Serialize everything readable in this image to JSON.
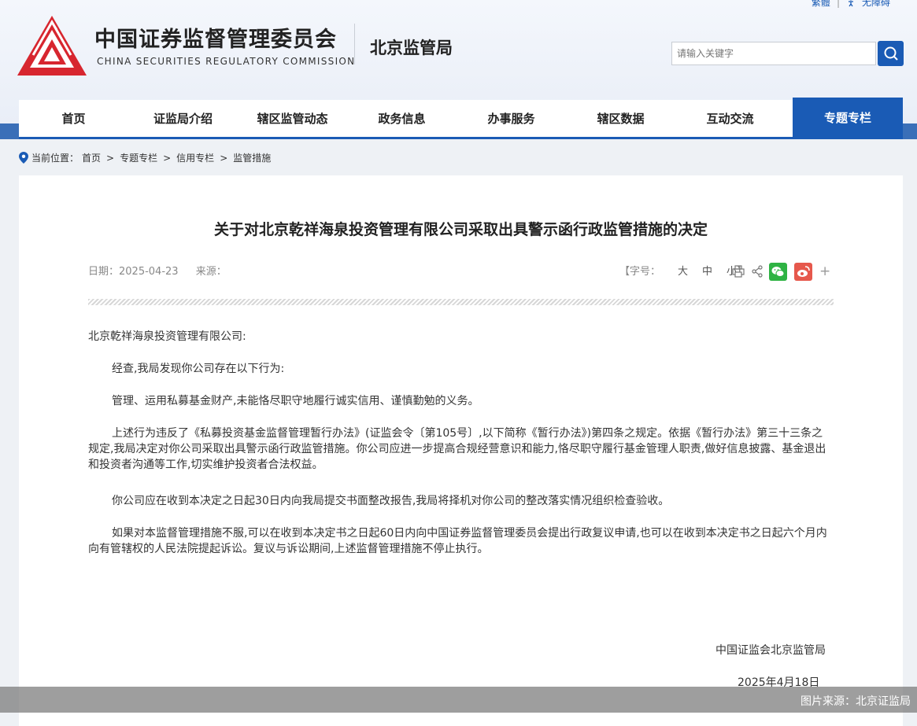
{
  "header": {
    "top_links": [
      "繁體",
      "无障碍"
    ],
    "org_name_cn": "中国证券监督管理委员会",
    "org_name_en": "CHINA SECURITIES REGULATORY COMMISSION",
    "bureau": "北京监管局",
    "search_placeholder": "请输入关键字",
    "colors": {
      "brand_red": "#d7262f",
      "brand_blue": "#1a5bb5"
    }
  },
  "nav": {
    "items": [
      "首页",
      "证监局介绍",
      "辖区监管动态",
      "政务信息",
      "办事服务",
      "辖区数据",
      "互动交流",
      "专题专栏"
    ],
    "active": "专题专栏"
  },
  "breadcrumb": {
    "prefix": "当前位置：",
    "items": [
      "首页",
      "专题专栏",
      "信用专栏",
      "监管措施"
    ],
    "separator": ">"
  },
  "article": {
    "title": "关于对北京乾祥海泉投资管理有限公司采取出具警示函行政监管措施的决定",
    "date_label": "日期：",
    "date": "2025-04-23",
    "source_label": "来源：",
    "font_size_label": "【字号：",
    "font_sizes": [
      "大",
      "中",
      "小"
    ],
    "font_size_close": "】",
    "paragraphs": [
      "北京乾祥海泉投资管理有限公司:",
      "经查,我局发现你公司存在以下行为:",
      "管理、运用私募基金财产,未能恪尽职守地履行诚实信用、谨慎勤勉的义务。",
      "上述行为违反了《私募投资基金监督管理暂行办法》(证监会令〔第105号〕,以下简称《暂行办法》)第四条之规定。依据《暂行办法》第三十三条之规定,我局决定对你公司采取出具警示函行政监管措施。你公司应进一步提高合规经营意识和能力,恪尽职守履行基金管理人职责,做好信息披露、基金退出和投资者沟通等工作,切实维护投资者合法权益。",
      "你公司应在收到本决定之日起30日内向我局提交书面整改报告,我局将择机对你公司的整改落实情况组织检查验收。",
      "如果对本监督管理措施不服,可以在收到本决定书之日起60日内向中国证券监督管理委员会提出行政复议申请,也可以在收到本决定书之日起六个月内向有管辖权的人民法院提起诉讼。复议与诉讼期间,上述监督管理措施不停止执行。"
    ],
    "signature_org": "中国证监会北京监管局",
    "signature_date": "2025年4月18日"
  },
  "footer": {
    "caption": "图片来源：北京证监局"
  }
}
